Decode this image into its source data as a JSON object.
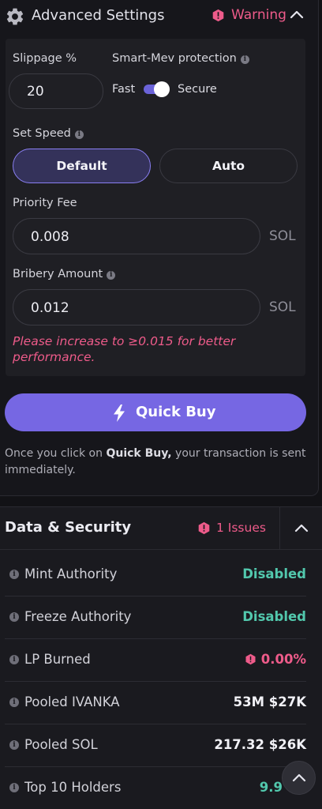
{
  "advanced": {
    "title": "Advanced Settings",
    "warning_label": "Warning",
    "slippage_label": "Slippage %",
    "slippage_value": "20",
    "mev_label": "Smart-Mev protection",
    "mev_left": "Fast",
    "mev_right": "Secure",
    "mev_secure_on": true,
    "speed_label": "Set Speed",
    "speed_options": [
      "Default",
      "Auto"
    ],
    "speed_selected": "Default",
    "priority_fee_label": "Priority Fee",
    "priority_fee_value": "0.008",
    "priority_fee_unit": "SOL",
    "bribery_label": "Bribery Amount",
    "bribery_value": "0.012",
    "bribery_unit": "SOL",
    "bribery_error": "Please increase to ≥0.015 for better performance."
  },
  "quick_buy": {
    "label": "Quick Buy",
    "notice_prefix": "Once you click on ",
    "notice_bold": "Quick Buy,",
    "notice_suffix": " your transaction is sent immediately."
  },
  "security": {
    "title": "Data & Security",
    "issues_label": "1 Issues",
    "rows": [
      {
        "name": "Mint Authority",
        "value": "Disabled",
        "status": "good"
      },
      {
        "name": "Freeze Authority",
        "value": "Disabled",
        "status": "good"
      },
      {
        "name": "LP Burned",
        "value": "0.00%",
        "status": "bad"
      },
      {
        "name": "Pooled IVANKA",
        "value": "53M $27K",
        "status": "neutral"
      },
      {
        "name": "Pooled SOL",
        "value": "217.32 $26K",
        "status": "neutral"
      },
      {
        "name": "Top 10 Holders",
        "value": "9.9",
        "status": "good"
      }
    ]
  },
  "colors": {
    "accent": "#7667e3",
    "warning": "#ee5b8a",
    "success": "#52c8ad",
    "background": "#121216"
  },
  "icons": {
    "settings": "gear-icon",
    "warning": "warning-hexagon-icon",
    "collapse": "chevron-up-icon",
    "info": "info-icon",
    "quick_buy": "lightning-bolt-icon",
    "scroll_top": "chevron-up-icon"
  }
}
